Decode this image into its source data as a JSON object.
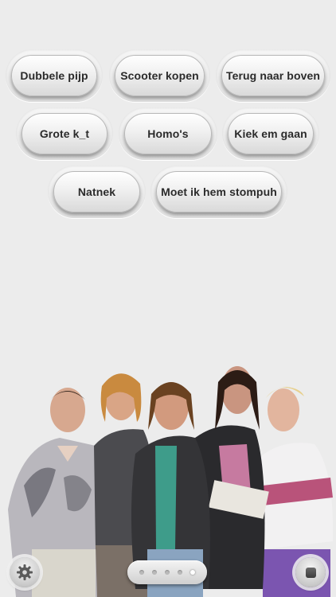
{
  "buttons": [
    {
      "id": "dubbele-pijp",
      "label": "Dubbele pijp"
    },
    {
      "id": "scooter-kopen",
      "label": "Scooter kopen"
    },
    {
      "id": "terug-naar-boven",
      "label": "Terug naar boven"
    },
    {
      "id": "grote-k",
      "label": "Grote k_t"
    },
    {
      "id": "homos",
      "label": "Homo's"
    },
    {
      "id": "kiek-em-gaan",
      "label": "Kiek em gaan"
    },
    {
      "id": "natnek",
      "label": "Natnek"
    },
    {
      "id": "moet-ik-hem-stompuh",
      "label": "Moet ik hem stompuh"
    }
  ],
  "pager": {
    "count": 5,
    "active": 4
  },
  "icons": {
    "settings": "gear-icon",
    "stop": "stop-icon"
  }
}
